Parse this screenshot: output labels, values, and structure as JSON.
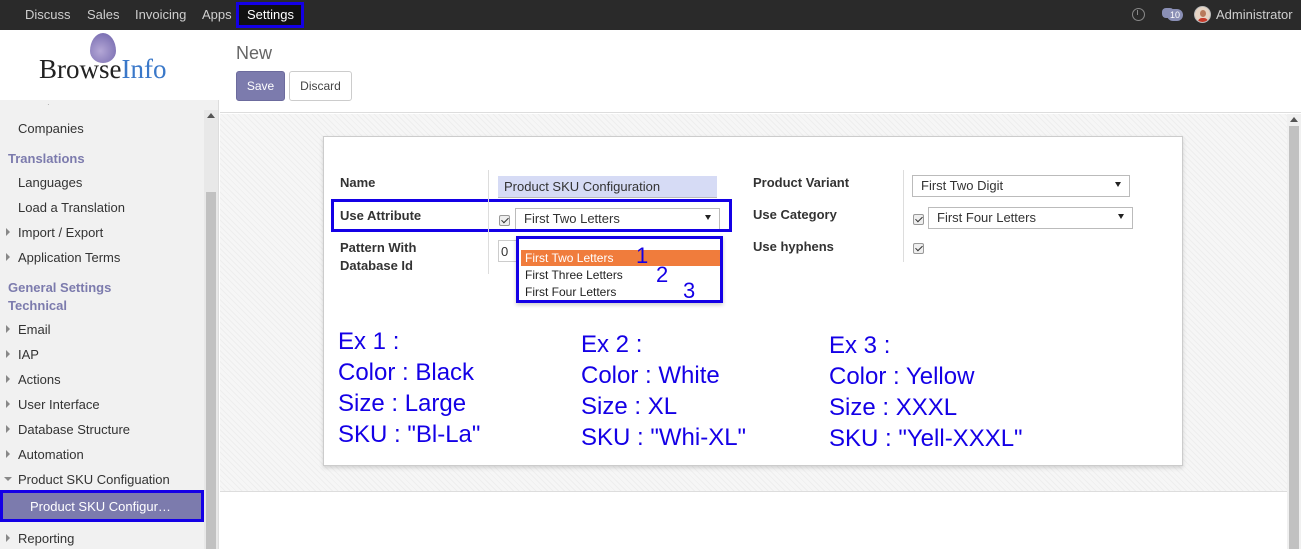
{
  "nav": {
    "items": [
      "Discuss",
      "Sales",
      "Invoicing",
      "Apps"
    ],
    "active": "Settings",
    "badge_count": "10",
    "user": "Administrator"
  },
  "logo": {
    "part1": "Browse",
    "part2": "Info"
  },
  "sidebar": {
    "cut_item": "·",
    "companies": "Companies",
    "translations_head": "Translations",
    "languages": "Languages",
    "load_translation": "Load a Translation",
    "import_export": "Import / Export",
    "application_terms": "Application Terms",
    "general_settings_head": "General Settings",
    "technical_head": "Technical",
    "email": "Email",
    "iap": "IAP",
    "actions": "Actions",
    "user_interface": "User Interface",
    "database_structure": "Database Structure",
    "automation": "Automation",
    "product_sku_configuation": "Product SKU Configuation",
    "product_sku_configur": "Product SKU Configur…",
    "reporting": "Reporting"
  },
  "control_panel": {
    "breadcrumb": "New",
    "save": "Save",
    "discard": "Discard"
  },
  "form": {
    "name_label": "Name",
    "name_value": "Product SKU Configuration",
    "use_attribute_label": "Use Attribute",
    "use_attribute_value": "First Two Letters",
    "pattern_label_line1": "Pattern With",
    "pattern_label_line2": "Database Id",
    "pattern_value": "0",
    "product_variant_label": "Product Variant",
    "product_variant_value": "First Two Digit",
    "use_category_label": "Use Category",
    "use_category_value": "First Four Letters",
    "use_hyphens_label": "Use hyphens"
  },
  "dropdown": {
    "options": [
      "First Two Letters",
      "First Three Letters",
      "First Four Letters"
    ],
    "numbers": [
      "1",
      "2",
      "3"
    ]
  },
  "examples": [
    {
      "title": "Ex 1 :",
      "color": "Color : Black",
      "size": "Size : Large",
      "sku": "SKU : \"Bl-La\""
    },
    {
      "title": "Ex 2 :",
      "color": "Color : White",
      "size": "Size : XL",
      "sku": "SKU : \"Whi-XL\""
    },
    {
      "title": "Ex 3 :",
      "color": "Color : Yellow",
      "size": "Size : XXXL",
      "sku": "SKU : \"Yell-XXXL\""
    }
  ],
  "colors": {
    "navbar": "#2a2a2a",
    "primary": "#7c7bad",
    "highlight": "#1400e6",
    "selected_option": "#f07c3c"
  }
}
